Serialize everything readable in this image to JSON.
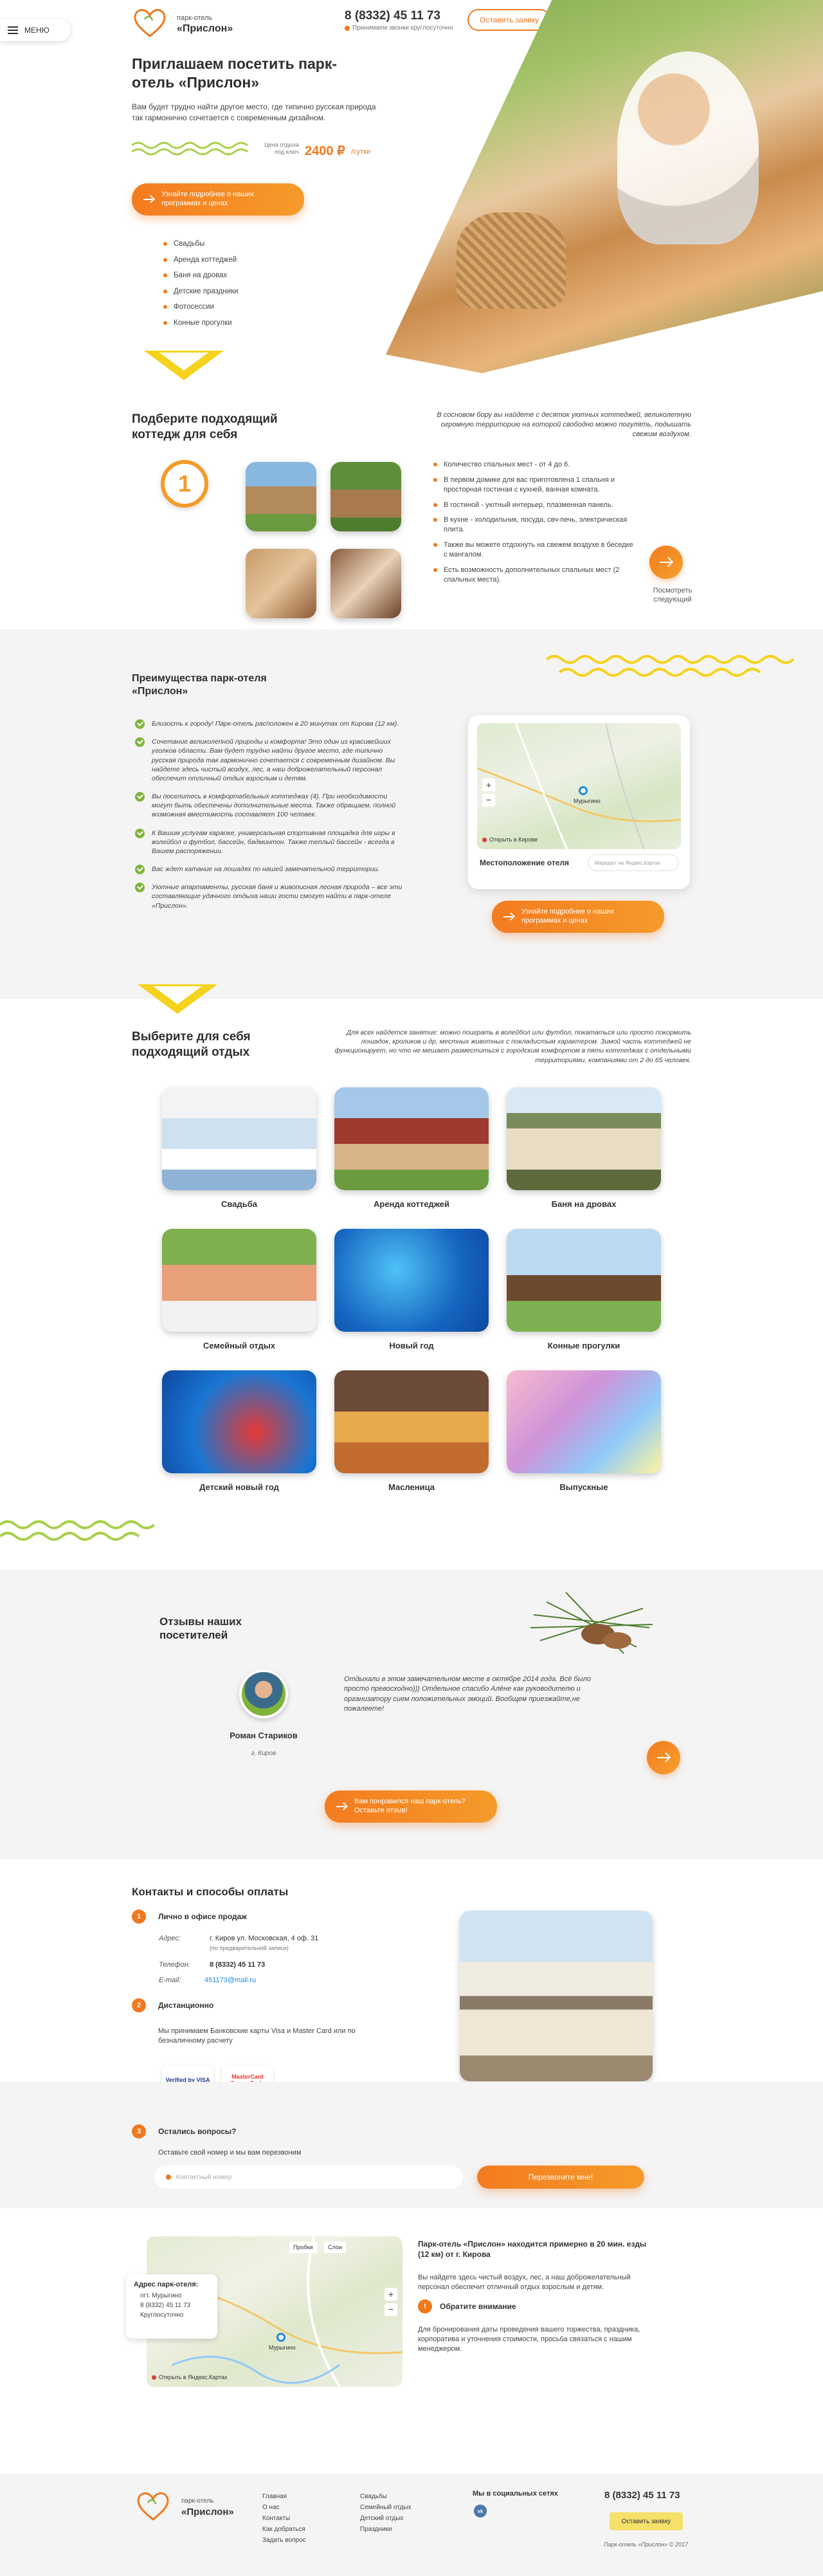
{
  "header": {
    "menu_label": "МЕНЮ",
    "logo_small": "парк-отель",
    "logo_big": "«Прислон»",
    "phone": "8 (8332) 45 11 73",
    "phone_note": "Принимаем звонки круглосуточно",
    "cta_label": "Оставить заявку"
  },
  "hero": {
    "title": "Приглашаем посетить парк-отель «Прислон»",
    "subtitle": "Вам будет трудно найти другое место, где типично русская природа так гармонично сочетается с современным дизайном.",
    "price_caption": "Цена отдыха под ключ",
    "price_value": "2400 ₽",
    "price_unit": "/сутки",
    "button_label": "Узнайте подробнее о наших программах и ценах",
    "services": [
      "Свадьбы",
      "Аренда коттеджей",
      "Баня на дровах",
      "Детские праздники",
      "Фотосессии",
      "Конные прогулки"
    ]
  },
  "cottages": {
    "title": "Подберите подходящий коттедж для себя",
    "number": "1",
    "intro": "В сосновом бору вы найдете с десяток уютных коттеджей, великолепную огромную территорию на которой свободно можно погулять, подышать свежим воздухом.",
    "features": [
      "Количество спальных мест - от 4 до 6.",
      "В первом домике для вас приготовлена 1 спальня и просторная гостиная с кухней, ванная комната.",
      "В гостиной - уютный интерьер, плазменная панель.",
      "В кухне - холодильник, посуда, свч-печь, электрическая плита.",
      "Также вы можете отдохнуть на свежем воздухе в беседке с мангалом.",
      "Есть возможность дополнительных спальных мест (2 спальных места)."
    ],
    "next_label": "Посмотреть следующий"
  },
  "advantages": {
    "title": "Преимущества парк-отеля «Прислон»",
    "items": [
      "Близость к городу! Парк-отель расположен в 20 минутах от Кирова (12 км).",
      "Сочетание великолепной природы и комфорта! Это один из красивейших уголков области. Вам будет трудно найти другое место, где типично русская природа так гармонично сочетается с современным дизайном. Вы найдете здесь чистый воздух, лес, а наш доброжелательный персонал обеспечит отличный отдых взрослым и детям.",
      "Вы поселитесь в комфортабельных коттеджах (4). При необходимости могут быть обеспечены дополнительные места. Также обращаем, полной возможная вместимость составляет 100 человек.",
      "К Вашим услугам караоке, универсальная спортивная площадка для игры в волейбол и футбол, бассейн, бадминтон. Также теплый бассейн - всегда в Вашем распоряжении.",
      "Вас ждет катание на лошадях по нашей замечательной территории.",
      "Уютные апартаменты, русская баня и живописная лесная природа – все эти составляющие удачного отдыха наши гости смогут найти в парк-отеле «Прислон»."
    ],
    "map_title": "Местоположение отеля",
    "map_open": "Открыть в Кирове",
    "map_search_placeholder": "Маршрут на Яндекс.Картах",
    "map_town": "Мурыгино",
    "button_label": "Узнайте подробнее о наших программах и ценах"
  },
  "activities": {
    "title": "Выберите для себя подходящий отдых",
    "intro": "Для всех найдется занятие: можно поиграть в волейбол или футбол, покататься или просто покормить лошадок, кроликов и др. местных животных с покладистым характером. Зимой часть коттеджей не функционирует, но что не мешает разместиться с городским комфортом в пяти коттеджах с отдельными территориями, компаниями от 2 до 65 человек.",
    "cards": [
      "Свадьба",
      "Аренда коттеджей",
      "Баня на дровах",
      "Семейный отдых",
      "Новый год",
      "Конные прогулки",
      "Детский новый год",
      "Масленица",
      "Выпускные"
    ]
  },
  "reviews": {
    "title": "Отзывы наших посетителей",
    "author": "Роман Стариков",
    "city": "г. Киров",
    "text": "Отдыхали в этом замечательном месте в октябре 2014 года. Всё было просто превосходно))) Отдельное спасибо Алёне как руководителю и организатору сием положительных эмоций. Вообщем приезжайте,не пожалеете!",
    "button_label": "Вам понравился наш парк-отель? Оставьте отзыв!"
  },
  "contacts": {
    "title": "Контакты и способы оплаты",
    "step1_title": "Лично в офисе продаж",
    "address_label": "Адрес:",
    "address_value": "г. Киров ул. Московская, 4 оф. 31",
    "address_note": "(по предварительной записи)",
    "phone_label": "Телефон:",
    "phone_value": "8 (8332) 45 11 73",
    "email_label": "E-mail:",
    "email_value": "451173@mail.ru",
    "step2_title": "Дистанционно",
    "step2_text": "Мы принимаем Банковские карты Visa и Master Card или по безналичному расчету",
    "visa_label": "Verified by VISA",
    "mc_label": "MasterCard SecureCode",
    "step3_title": "Остались вопросы?",
    "step3_text": "Оставьте свой номер и мы вам перезвоним",
    "phone_placeholder": "Контактный номер",
    "callback_label": "Перезвоните мне!"
  },
  "location": {
    "addr_title": "Адрес парк-отеля:",
    "addr_lines": [
      "пгт. Мурыгино",
      "8 (8332) 45 11 73",
      "Круглосуточно"
    ],
    "map_town": "Мурыгино",
    "map_open": "Открыть в Яндекс.Картах",
    "map_traffic": "Пробки",
    "map_layers": "Слои",
    "heading": "Парк-отель «Прислон» находится примерно в 20 мин. езды (12 км) от г. Кирова",
    "text": "Вы найдете здесь чистый воздух, лес, а наш доброжелательный персонал обеспечит отличный отдых взрослым и детям.",
    "note_title": "Обратите внимание",
    "note_text": "Для бронирования даты проведения вашего торжества, праздника, корпоратива и уточнения стоимости, просьба связаться с нашим менеджером."
  },
  "footer": {
    "logo_small": "парк-отель",
    "logo_big": "«Прислон»",
    "col1": [
      "Главная",
      "О нас",
      "Контакты",
      "Как добраться",
      "Задать вопрос"
    ],
    "col2": [
      "Свадьбы",
      "Семейный отдых",
      "Детский отдых",
      "Праздники"
    ],
    "social_title": "Мы в социальных сетях",
    "phone": "8 (8332) 45 11 73",
    "cta_label": "Оставить заявку",
    "copyright": "Парк-отель «Прислон» © 2017"
  },
  "colors": {
    "accent": "#f0791f",
    "yellow": "#f5d21c",
    "green": "#7fb43a"
  }
}
